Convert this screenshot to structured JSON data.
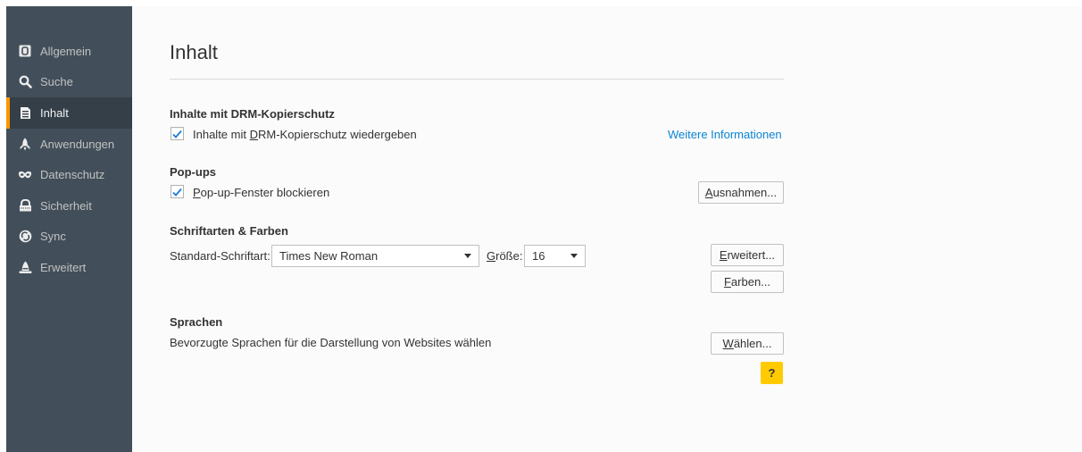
{
  "sidebar": {
    "items": [
      {
        "label": "Allgemein",
        "icon": "general-icon"
      },
      {
        "label": "Suche",
        "icon": "search-icon"
      },
      {
        "label": "Inhalt",
        "icon": "content-document-icon",
        "active": true
      },
      {
        "label": "Anwendungen",
        "icon": "rocket-icon"
      },
      {
        "label": "Datenschutz",
        "icon": "mask-icon"
      },
      {
        "label": "Sicherheit",
        "icon": "security-icon"
      },
      {
        "label": "Sync",
        "icon": "sync-icon"
      },
      {
        "label": "Erweitert",
        "icon": "wizard-hat-icon"
      }
    ]
  },
  "main": {
    "title": "Inhalt",
    "drm": {
      "heading": "Inhalte mit DRM-Kopierschutz",
      "checkbox_pre": "Inhalte mit ",
      "checkbox_mnemonic": "D",
      "checkbox_post": "RM-Kopierschutz wiedergeben",
      "checked": true,
      "link": "Weitere Informationen"
    },
    "popups": {
      "heading": "Pop-ups",
      "checkbox_mnemonic": "P",
      "checkbox_post": "op-up-Fenster blockieren",
      "checked": true,
      "button_mnemonic": "A",
      "button_rest": "usnahmen..."
    },
    "fonts": {
      "heading": "Schriftarten & Farben",
      "font_label": "Standard-Schriftart:",
      "font_value": "Times New Roman",
      "size_label_mnemonic": "G",
      "size_label_rest": "röße:",
      "size_value": "16",
      "advanced_mnemonic": "E",
      "advanced_rest": "rweitert...",
      "colors_mnemonic": "F",
      "colors_rest": "arben..."
    },
    "languages": {
      "heading": "Sprachen",
      "text": "Bevorzugte Sprachen für die Darstellung von Websites wählen",
      "button_mnemonic": "W",
      "button_rest": "ählen..."
    },
    "help": "?"
  },
  "colors": {
    "sidebar_bg": "#424f5a",
    "sidebar_active_bg": "#343f48",
    "accent": "#ff9500",
    "link": "#0a84d6",
    "help": "#ffcb00"
  }
}
